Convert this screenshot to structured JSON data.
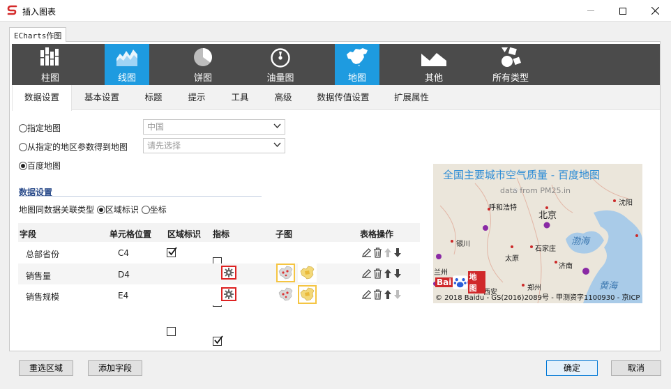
{
  "window": {
    "title": "插入图表"
  },
  "outer_tab": "ECharts作图",
  "chart_types": [
    {
      "label": "柱图",
      "icon": "bar-chart-icon",
      "active": false
    },
    {
      "label": "线图",
      "icon": "area-chart-icon",
      "active": true
    },
    {
      "label": "饼图",
      "icon": "pie-chart-icon",
      "active": false
    },
    {
      "label": "油量图",
      "icon": "gauge-icon",
      "active": false
    },
    {
      "label": "地图",
      "icon": "china-map-icon",
      "active": true
    },
    {
      "label": "其他",
      "icon": "mountain-icon",
      "active": false
    },
    {
      "label": "所有类型",
      "icon": "shapes-icon",
      "active": false
    }
  ],
  "settings_tabs": [
    "数据设置",
    "基本设置",
    "标题",
    "提示",
    "工具",
    "高级",
    "数据传值设置",
    "扩展属性"
  ],
  "map_source": {
    "opt_specified": "指定地图",
    "opt_param": "从指定的地区参数得到地图",
    "opt_baidu": "百度地图",
    "selected": "百度地图",
    "specified_value": "中国",
    "param_placeholder": "请先选择"
  },
  "data_settings": {
    "heading": "数据设置",
    "assoc_label": "地图同数据关联类型",
    "opt_region": "区域标识",
    "opt_coord": "坐标",
    "selected": "区域标识"
  },
  "table": {
    "headers": [
      "字段",
      "单元格位置",
      "区域标识",
      "指标",
      "子图",
      "表格操作"
    ],
    "rows": [
      {
        "field": "总部省份",
        "cell": "C4",
        "region": true,
        "metric": false,
        "has_gear": false,
        "has_sub": false
      },
      {
        "field": "销售量",
        "cell": "D4",
        "region": false,
        "metric": true,
        "has_gear": true,
        "has_sub": true,
        "sub_selected": 0
      },
      {
        "field": "销售规模",
        "cell": "E4",
        "region": false,
        "metric": true,
        "has_gear": true,
        "has_sub": true,
        "sub_selected": 1
      }
    ]
  },
  "preview": {
    "title": "全国主要城市空气质量 - 百度地图",
    "subtitle": "data from PM25.in",
    "cities": [
      "呼和浩特",
      "沈阳",
      "北京",
      "银川",
      "石家庄",
      "太原",
      "济南",
      "兰州",
      "郑州",
      "西安"
    ],
    "seas": [
      "渤海",
      "黄海"
    ],
    "logo_text": "Bai",
    "logo_text2": "地图",
    "copyright": "© 2018 Baidu - GS(2016)2089号 - 甲测资字1100930 - 京ICP"
  },
  "buttons": {
    "reselect": "重选区域",
    "add_field": "添加字段",
    "ok": "确定",
    "cancel": "取消"
  },
  "colors": {
    "accent": "#1e9be0",
    "toolbar": "#4b4b4b",
    "preview_title": "#2a8bd6",
    "point": "#8a2aa5",
    "marker": "#cc2a2a"
  }
}
